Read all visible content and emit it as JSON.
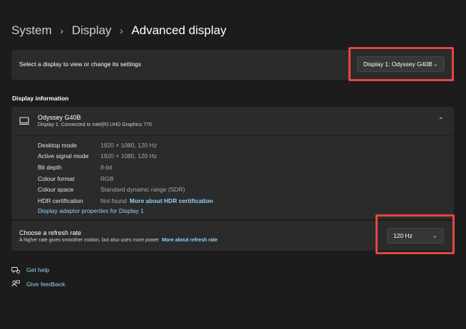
{
  "breadcrumb": {
    "items": [
      "System",
      "Display",
      "Advanced display"
    ]
  },
  "display_select": {
    "label": "Select a display to view or change its settings",
    "value": "Display 1: Odyssey G40B"
  },
  "display_info": {
    "section_title": "Display information",
    "monitor_name": "Odyssey G40B",
    "monitor_sub": "Display 1: Connected to Intel(R) UHD Graphics 770",
    "rows": [
      {
        "key": "Desktop mode",
        "value": "1920 × 1080, 120 Hz"
      },
      {
        "key": "Active signal mode",
        "value": "1920 × 1080, 120 Hz"
      },
      {
        "key": "Bit depth",
        "value": "8-bit"
      },
      {
        "key": "Colour format",
        "value": "RGB"
      },
      {
        "key": "Colour space",
        "value": "Standard dynamic range (SDR)"
      },
      {
        "key": "HDR certification",
        "value": "Not found",
        "link": "More about HDR certification"
      }
    ],
    "adaptor_link": "Display adaptor properties for Display 1"
  },
  "refresh_rate": {
    "title": "Choose a refresh rate",
    "description": "A higher rate gives smoother motion, but also uses more power",
    "link": "More about refresh rate",
    "value": "120 Hz"
  },
  "footer": {
    "help": "Get help",
    "feedback": "Give feedback"
  },
  "colors": {
    "background": "#1c1c1c",
    "card": "#2b2b2b",
    "link": "#8fd2ff",
    "highlight": "#e64545"
  }
}
